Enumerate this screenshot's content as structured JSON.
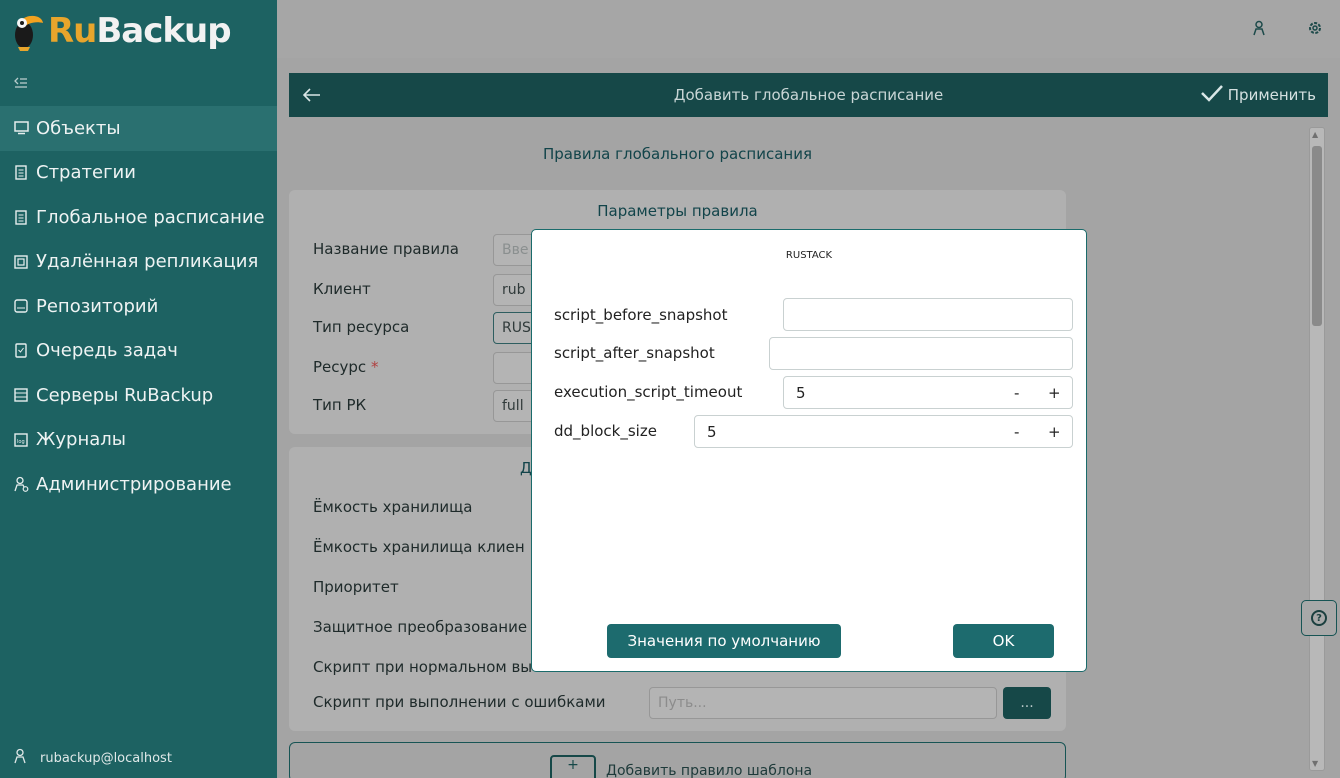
{
  "app": {
    "logo_ru": "Ru",
    "logo_backup": "Backup"
  },
  "sidebar": {
    "collapse_icon": "collapse-icon",
    "items": [
      {
        "label": "Объекты",
        "icon": "monitor-icon"
      },
      {
        "label": "Стратегии",
        "icon": "document-icon"
      },
      {
        "label": "Глобальное расписание",
        "icon": "calendar-list-icon"
      },
      {
        "label": "Удалённая репликация",
        "icon": "replication-icon"
      },
      {
        "label": "Репозиторий",
        "icon": "repository-icon"
      },
      {
        "label": "Очередь задач",
        "icon": "queue-icon"
      },
      {
        "label": "Серверы RuBackup",
        "icon": "server-icon"
      },
      {
        "label": "Журналы",
        "icon": "log-icon"
      },
      {
        "label": "Администрирование",
        "icon": "admin-icon"
      }
    ],
    "user": "rubackup@localhost"
  },
  "header": {
    "title": "Добавить глобальное расписание",
    "apply_label": "Применить"
  },
  "main": {
    "section_title": "Правила глобального расписания",
    "params_title": "Параметры правила",
    "fields": [
      {
        "label": "Название правила",
        "value": "Вве"
      },
      {
        "label": "Клиент",
        "value": "rub"
      },
      {
        "label": "Тип ресурса",
        "value": "RUS"
      },
      {
        "label": "Ресурс",
        "required": "*",
        "value": ""
      },
      {
        "label": "Тип РК",
        "value": "full"
      }
    ],
    "panel2_title_fragment": "Д",
    "panel2_labels": [
      "Ёмкость хранилища",
      "Ёмкость хранилища клиен",
      "Приоритет",
      "Защитное преобразование",
      "Скрипт при нормальном вы",
      "Скрипт при выполнении с ошибками"
    ],
    "path_placeholder": "Путь...",
    "dots_label": "...",
    "add_label": "Добавить правило шаблона"
  },
  "modal": {
    "title": "RUSTACK",
    "fields": [
      {
        "label": "script_before_snapshot",
        "value": ""
      },
      {
        "label": "script_after_snapshot",
        "value": ""
      },
      {
        "label": "execution_script_timeout",
        "value": "5"
      },
      {
        "label": "dd_block_size",
        "value": "5"
      }
    ],
    "minus": "-",
    "plus": "+",
    "defaults_button": "Значения по умолчанию",
    "ok_button": "OK"
  }
}
